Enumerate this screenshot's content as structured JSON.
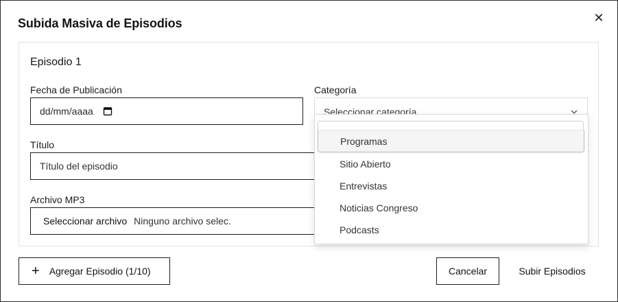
{
  "modal": {
    "title": "Subida Masiva de Episodios",
    "close_icon": "close-icon"
  },
  "episode": {
    "title": "Episodio 1",
    "date": {
      "label": "Fecha de Publicación",
      "placeholder": "dd/mm/aaaa",
      "icon": "calendar-icon"
    },
    "category": {
      "label": "Categoría",
      "placeholder": "Seleccionar categoría...",
      "icon": "chevron-down-icon"
    },
    "title_field": {
      "label": "Título",
      "placeholder": "Título del episodio"
    },
    "file": {
      "label": "Archivo MP3",
      "button": "Seleccionar archivo",
      "status": "Ninguno archivo selec."
    }
  },
  "dropdown": {
    "options": [
      "Programas",
      "Sitio Abierto",
      "Entrevistas",
      "Noticias Congreso",
      "Podcasts"
    ],
    "highlighted": "Programas"
  },
  "footer": {
    "add_label": "Agregar Episodio (1/10)",
    "add_icon": "plus-icon",
    "cancel_label": "Cancelar",
    "submit_label": "Subir Episodios"
  }
}
